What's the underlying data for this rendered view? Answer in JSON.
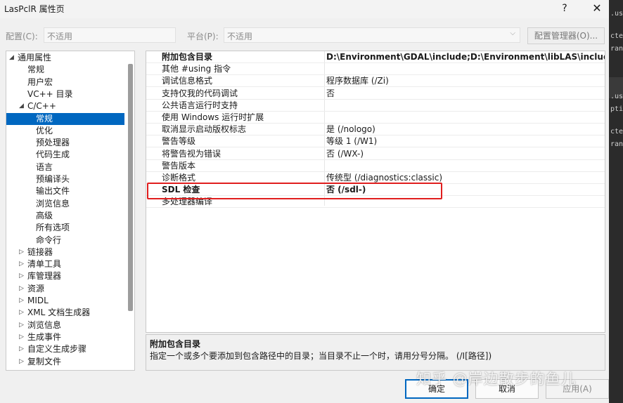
{
  "window": {
    "title": "LasPclR 属性页",
    "help_label": "?",
    "close_label": "✕"
  },
  "config_bar": {
    "config_label": "配置(C):",
    "config_value": "不适用",
    "platform_label": "平台(P):",
    "platform_value": "不适用",
    "manager_button": "配置管理器(O)..."
  },
  "tree": {
    "items": [
      {
        "label": "通用属性",
        "toggle": "◢",
        "level": 0
      },
      {
        "label": "常规",
        "toggle": "",
        "level": 1
      },
      {
        "label": "用户宏",
        "toggle": "",
        "level": 1
      },
      {
        "label": "VC++ 目录",
        "toggle": "",
        "level": 1
      },
      {
        "label": "C/C++",
        "toggle": "◢",
        "level": 1
      },
      {
        "label": "常规",
        "toggle": "",
        "level": 2,
        "selected": true
      },
      {
        "label": "优化",
        "toggle": "",
        "level": 2
      },
      {
        "label": "预处理器",
        "toggle": "",
        "level": 2
      },
      {
        "label": "代码生成",
        "toggle": "",
        "level": 2
      },
      {
        "label": "语言",
        "toggle": "",
        "level": 2
      },
      {
        "label": "预编译头",
        "toggle": "",
        "level": 2
      },
      {
        "label": "输出文件",
        "toggle": "",
        "level": 2
      },
      {
        "label": "浏览信息",
        "toggle": "",
        "level": 2
      },
      {
        "label": "高级",
        "toggle": "",
        "level": 2
      },
      {
        "label": "所有选项",
        "toggle": "",
        "level": 2
      },
      {
        "label": "命令行",
        "toggle": "",
        "level": 2
      },
      {
        "label": "链接器",
        "toggle": "▷",
        "level": 1
      },
      {
        "label": "清单工具",
        "toggle": "▷",
        "level": 1
      },
      {
        "label": "库管理器",
        "toggle": "▷",
        "level": 1
      },
      {
        "label": "资源",
        "toggle": "▷",
        "level": 1
      },
      {
        "label": "MIDL",
        "toggle": "▷",
        "level": 1
      },
      {
        "label": "XML 文档生成器",
        "toggle": "▷",
        "level": 1
      },
      {
        "label": "浏览信息",
        "toggle": "▷",
        "level": 1
      },
      {
        "label": "生成事件",
        "toggle": "▷",
        "level": 1
      },
      {
        "label": "自定义生成步骤",
        "toggle": "▷",
        "level": 1
      },
      {
        "label": "复制文件",
        "toggle": "▷",
        "level": 1
      }
    ]
  },
  "properties": [
    {
      "name": "附加包含目录",
      "value": "D:\\Environment\\GDAL\\include;D:\\Environment\\libLAS\\include;D:\\",
      "bold_value": true
    },
    {
      "name": "其他 #using 指令",
      "value": ""
    },
    {
      "name": "调试信息格式",
      "value": "程序数据库 (/Zi)"
    },
    {
      "name": "支持仅我的代码调试",
      "value": "否"
    },
    {
      "name": "公共语言运行时支持",
      "value": ""
    },
    {
      "name": "使用 Windows 运行时扩展",
      "value": ""
    },
    {
      "name": "取消显示启动版权标志",
      "value": "是 (/nologo)"
    },
    {
      "name": "警告等级",
      "value": "等级 1 (/W1)"
    },
    {
      "name": "将警告视为错误",
      "value": "否 (/WX-)"
    },
    {
      "name": "警告版本",
      "value": ""
    },
    {
      "name": "诊断格式",
      "value": "传统型 (/diagnostics:classic)"
    },
    {
      "name": "SDL 检查",
      "value": "否 (/sdl-)",
      "bold_value": true
    },
    {
      "name": "多处理器编译",
      "value": ""
    }
  ],
  "description": {
    "title": "附加包含目录",
    "text": "指定一个或多个要添加到包含路径中的目录；当目录不止一个时，请用分号分隔。    (/I[路径])"
  },
  "buttons": {
    "ok": "确定",
    "cancel": "取消",
    "apply": "应用(A)"
  },
  "watermark": "知乎 @岸边散步的鱼儿",
  "edge_fragments": [
    ".us",
    "cte",
    "ran",
    ".us",
    "pti",
    "cte",
    "ran"
  ]
}
